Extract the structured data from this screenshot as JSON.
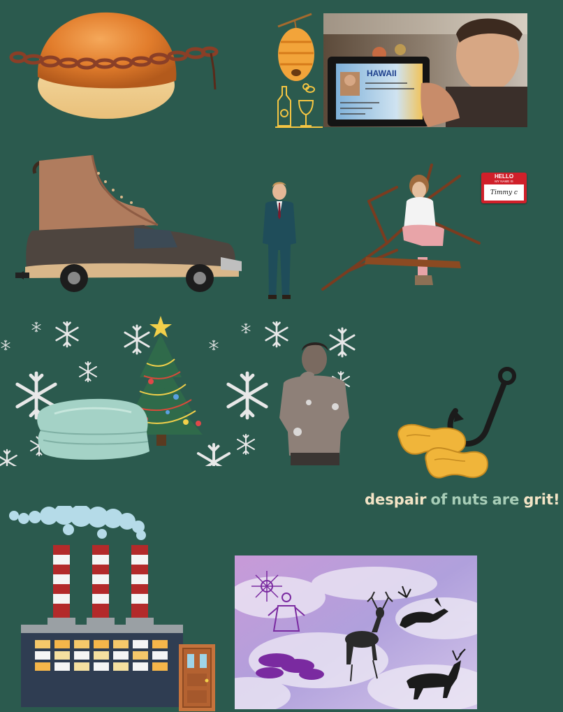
{
  "caption": {
    "word1": "despair",
    "word2": "of",
    "word3": "nuts",
    "word4": "are",
    "word5": "grit!"
  },
  "nametag": {
    "hello": "HELLO",
    "subtitle": "MY NAME IS",
    "name": "Timmy c"
  },
  "id_card": {
    "state": "HAWAII"
  },
  "colors": {
    "background": "#2b5a4e",
    "caption_highlight": "#f3e4c6",
    "caption_muted": "#a7cdb7"
  },
  "icons": [
    "bread-roll-with-chain",
    "beehive-mead-icon",
    "fake-id-photo",
    "boot-truck",
    "man-in-suit",
    "person-in-tree",
    "name-tag",
    "snowflake-banner",
    "christmas-tree",
    "folded-blanket",
    "shirtless-man",
    "fish-hook-with-peanuts",
    "factory-smokestacks",
    "purple-cloud-sky-with-deer"
  ]
}
